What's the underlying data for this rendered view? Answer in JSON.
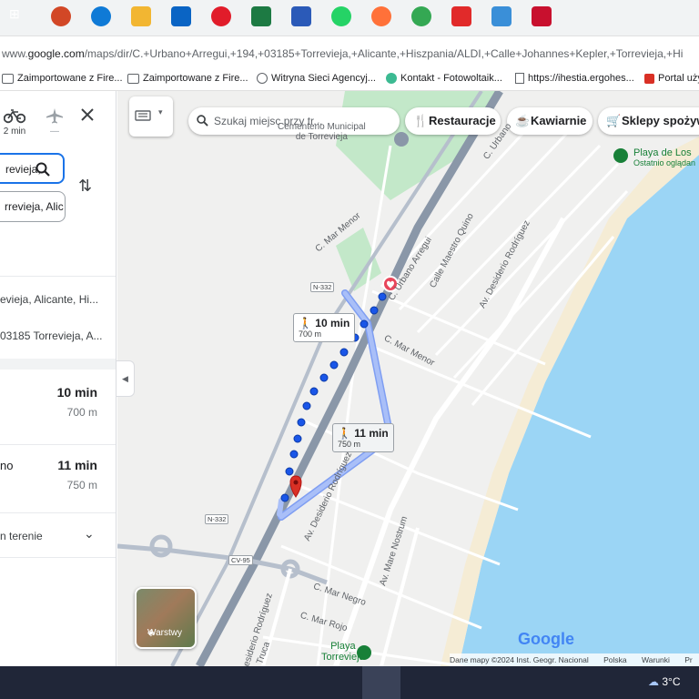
{
  "browser": {
    "url_prefix": "www.",
    "url_domain": "google.com",
    "url_rest": "/maps/dir/C.+Urbano+Arregui,+194,+03185+Torrevieja,+Alicante,+Hiszpania/ALDI,+Calle+Johannes+Kepler,+Torrevieja,+Hi",
    "bookmarks": [
      {
        "label": "Zaimportowane z Fire...",
        "icon": "folder-icon"
      },
      {
        "label": "Zaimportowane z Fire...",
        "icon": "folder-icon"
      },
      {
        "label": "Witryna Sieci Agencyj...",
        "icon": "globe-icon"
      },
      {
        "label": "Kontakt - Fotowoltaik...",
        "icon": "favicon"
      },
      {
        "label": "https://ihestia.ergohes...",
        "icon": "page-icon"
      },
      {
        "label": "Portal uży",
        "icon": "favicon"
      }
    ]
  },
  "panel": {
    "mode_bike_time": "2 min",
    "mode_flight_time": "—",
    "origin_value": "revieja,",
    "destination_value": "rrevieja, Alic",
    "waypoint_1": "evieja, Alicante, Hi...",
    "waypoint_2": "03185 Torrevieja, A...",
    "routes": [
      {
        "label": "",
        "time": "10 min",
        "distance": "700 m"
      },
      {
        "label": "no",
        "time": "11 min",
        "distance": "750 m"
      }
    ],
    "terrain_label": "n terenie"
  },
  "map": {
    "search_placeholder": "Szukaj miejsc przy tr...",
    "chips": [
      {
        "label": "Restauracje",
        "icon": "fork-knife-icon"
      },
      {
        "label": "Kawiarnie",
        "icon": "coffee-icon"
      },
      {
        "label": "Sklepy spożyw",
        "icon": "cart-icon"
      }
    ],
    "callout_primary": {
      "time": "10 min",
      "distance": "700 m"
    },
    "callout_alt": {
      "time": "11 min",
      "distance": "750 m"
    },
    "cemetery_label_1": "Cementerio Municipal",
    "cemetery_label_2": "de Torrevieja",
    "beach_label": "Playa de Los",
    "beach_sublabel": "Ostatnio oglądan",
    "playa_label_1": "Playa",
    "playa_label_2": "Torrevieja",
    "streets": {
      "mar_menor_1": "C. Mar Menor",
      "mar_menor_2": "C. Mar Menor",
      "urbano_arregui": "C. Urbano Arregui",
      "urbano_top": "C. Urbano",
      "maestro_quino": "Calle Maestro Quino",
      "desiderio_1": "Av. Desiderio Rodríguez",
      "desiderio_2": "Av. Desiderio Rodríguez",
      "desiderio_3": "Desiderio Rodríguez",
      "mar_negro": "C. Mar Negro",
      "mar_rojo": "C. Mar Rojo",
      "mare_nostrum": "Av. Mare Nostrum",
      "truca": "Truca"
    },
    "shields": {
      "n332_a": "N-332",
      "n332_b": "N-332",
      "cv95": "CV-95"
    },
    "layers_label": "Warstwy",
    "google_logo": "Google",
    "attribution": [
      "Dane mapy ©2024 Inst. Geogr. Nacional",
      "Polska",
      "Warunki",
      "Pr"
    ],
    "colors": {
      "route": "#1a56e8",
      "alt_route": "#a9bff8",
      "water": "#9bd5f5",
      "park": "#c3e8c9",
      "beach": "#f5ecd5"
    }
  },
  "taskbar": {
    "weather": "3°C",
    "apps": [
      "task-view",
      "powerpoint",
      "edge",
      "file-explorer",
      "outlook",
      "opera",
      "excel",
      "word",
      "whatsapp",
      "firefox",
      "chrome",
      "acrobat",
      "paint",
      "mcafee"
    ]
  }
}
